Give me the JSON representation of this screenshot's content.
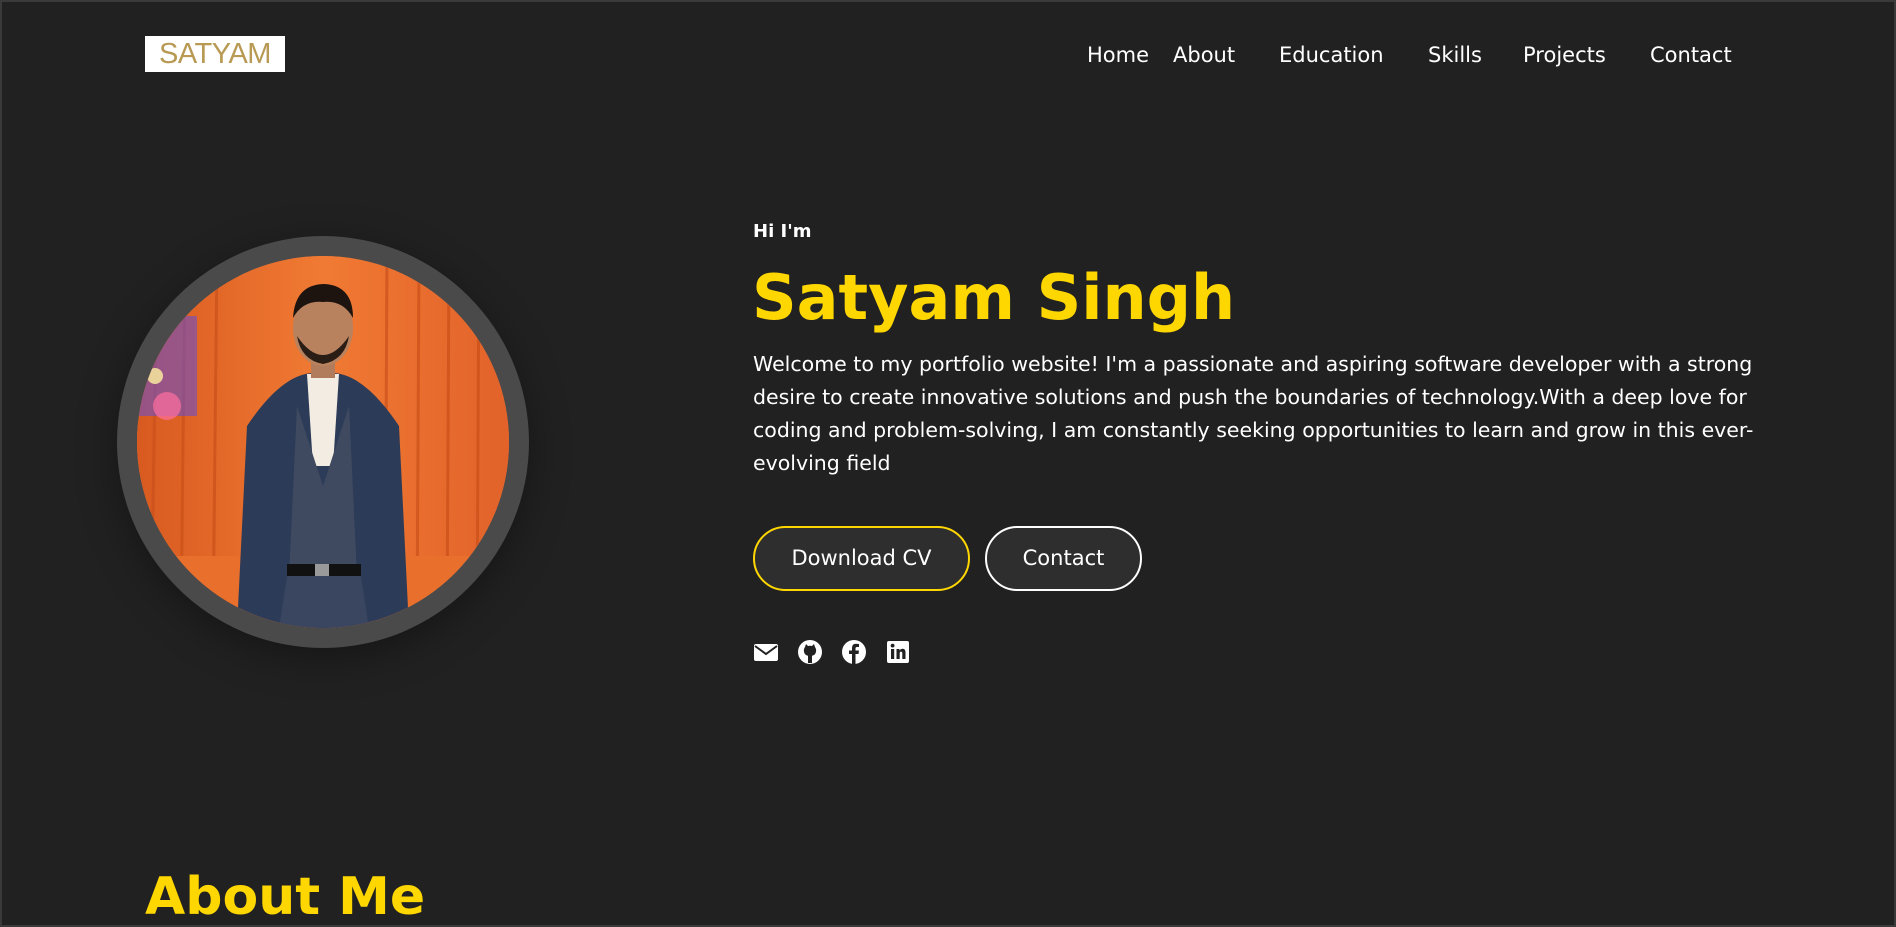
{
  "logo": {
    "text": "SATYAM"
  },
  "nav": {
    "items": [
      {
        "label": "Home"
      },
      {
        "label": "About"
      },
      {
        "label": "Education"
      },
      {
        "label": "Skills"
      },
      {
        "label": "Projects"
      },
      {
        "label": "Contact"
      }
    ]
  },
  "hero": {
    "greeting": "Hi I'm",
    "name": "Satyam Singh",
    "intro": "Welcome to my portfolio website! I'm a passionate and aspiring software developer with a strong desire to create innovative solutions and push the boundaries of technology.With a deep love for coding and problem-solving, I am constantly seeking opportunities to learn and grow in this ever-evolving field",
    "buttons": {
      "download_cv": "Download CV",
      "contact": "Contact"
    },
    "socials": [
      {
        "icon": "envelope-icon"
      },
      {
        "icon": "github-icon"
      },
      {
        "icon": "facebook-icon"
      },
      {
        "icon": "linkedin-icon"
      }
    ]
  },
  "about": {
    "title": "About Me"
  },
  "colors": {
    "background": "#212121",
    "accent": "#ffd700",
    "text": "#ffffff",
    "button_bg": "#2e2e2e",
    "avatar_ring": "#4a4a4a"
  }
}
